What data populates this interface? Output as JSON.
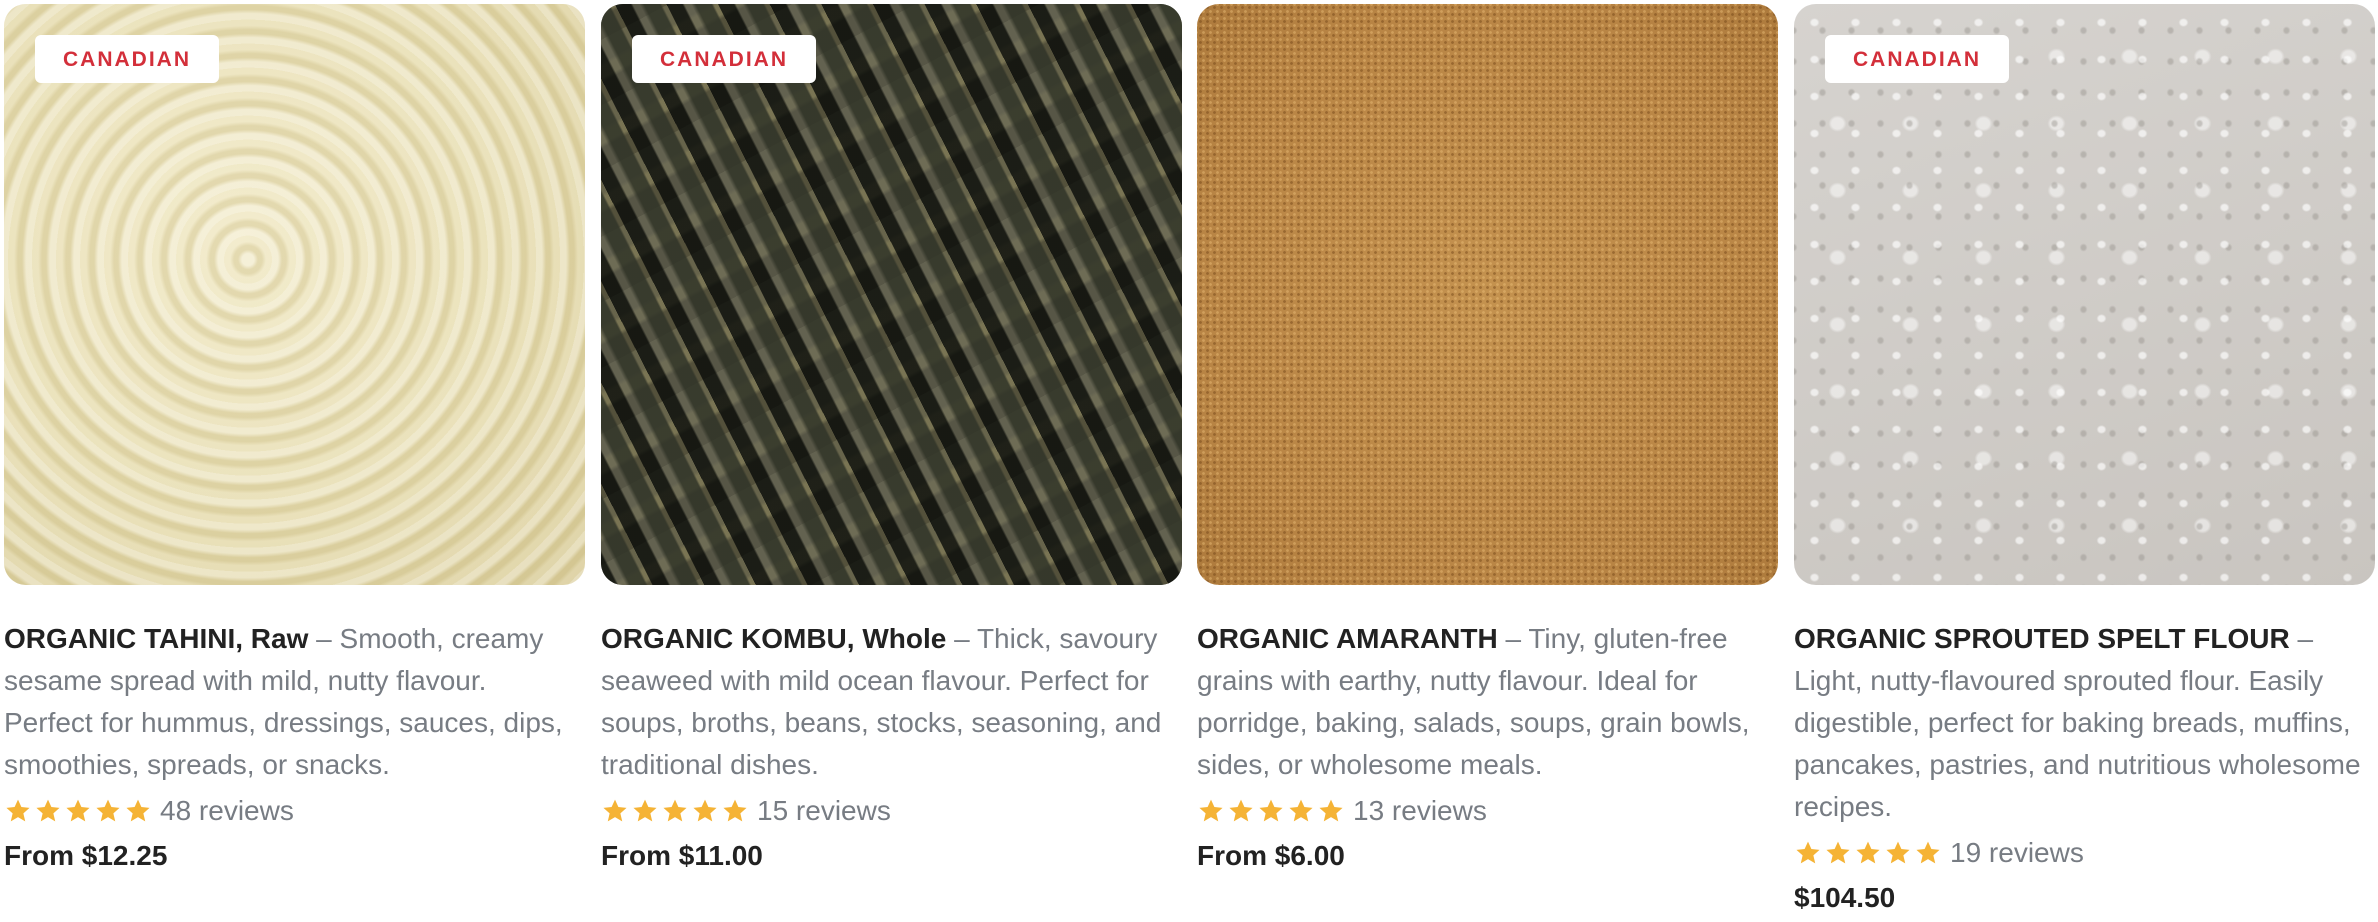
{
  "products": [
    {
      "badge": "CANADIAN",
      "name": "ORGANIC TAHINI, Raw",
      "description": " – Smooth, creamy sesame spread with mild, nutty flavour. Perfect for hummus, dressings, sauces, dips, smoothies, spreads, or snacks.",
      "rating": 5,
      "reviews": "48 reviews",
      "price": "From $12.25"
    },
    {
      "badge": "CANADIAN",
      "name": "ORGANIC KOMBU, Whole",
      "description": " – Thick, savoury seaweed with mild ocean flavour. Perfect for soups, broths, beans, stocks, seasoning, and traditional dishes.",
      "rating": 5,
      "reviews": "15 reviews",
      "price": "From $11.00"
    },
    {
      "badge": "",
      "name": "ORGANIC AMARANTH",
      "description": " – Tiny, gluten-free grains with earthy, nutty flavour. Ideal for porridge, baking, salads, soups, grain bowls, sides, or wholesome meals.",
      "rating": 5,
      "reviews": "13 reviews",
      "price": "From $6.00"
    },
    {
      "badge": "CANADIAN",
      "name": "ORGANIC SPROUTED SPELT FLOUR",
      "description": " – Light, nutty-flavoured sprouted flour. Easily digestible, perfect for baking breads, muffins, pancakes, pastries, and nutritious wholesome recipes.",
      "rating": 5,
      "reviews": "19 reviews",
      "price": "$104.50"
    }
  ],
  "colors": {
    "badge_text": "#d32f3a",
    "star": "#f5b335",
    "muted_text": "#777c83",
    "title_text": "#222222"
  },
  "icons": {
    "star": "star-icon"
  }
}
